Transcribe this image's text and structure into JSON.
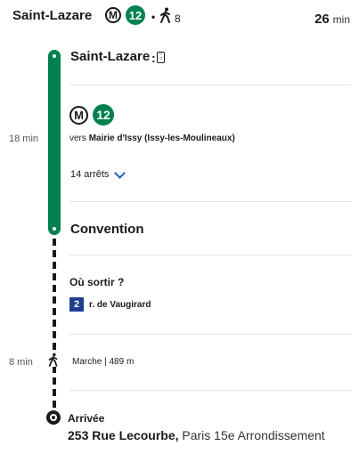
{
  "header": {
    "origin": "Saint-Lazare",
    "metro_badge": "M",
    "line": "12",
    "dot": "•",
    "walk_minutes": "8",
    "duration_value": "26",
    "duration_unit": "min"
  },
  "timeline": {
    "metro_time": "18 min",
    "walk_time": "8 min"
  },
  "segment_metro": {
    "departure_stop": "Saint-Lazare",
    "metro_badge": "M",
    "line": "12",
    "direction_prefix": "vers",
    "direction": "Mairie d'Issy (Issy-les-Moulineaux)",
    "stops_label": "14 arrêts",
    "arrival_stop": "Convention"
  },
  "exit": {
    "title": "Où sortir ?",
    "number": "2",
    "street": "r. de Vaugirard"
  },
  "walk": {
    "label": "Marche | 489 m"
  },
  "arrival": {
    "label": "Arrivée",
    "street": "253 Rue Lecourbe,",
    "city": "Paris 15e Arrondissement"
  },
  "colors": {
    "line12": "#00814f",
    "link": "#1f5fbf",
    "exit_badge": "#1d3f8f"
  }
}
